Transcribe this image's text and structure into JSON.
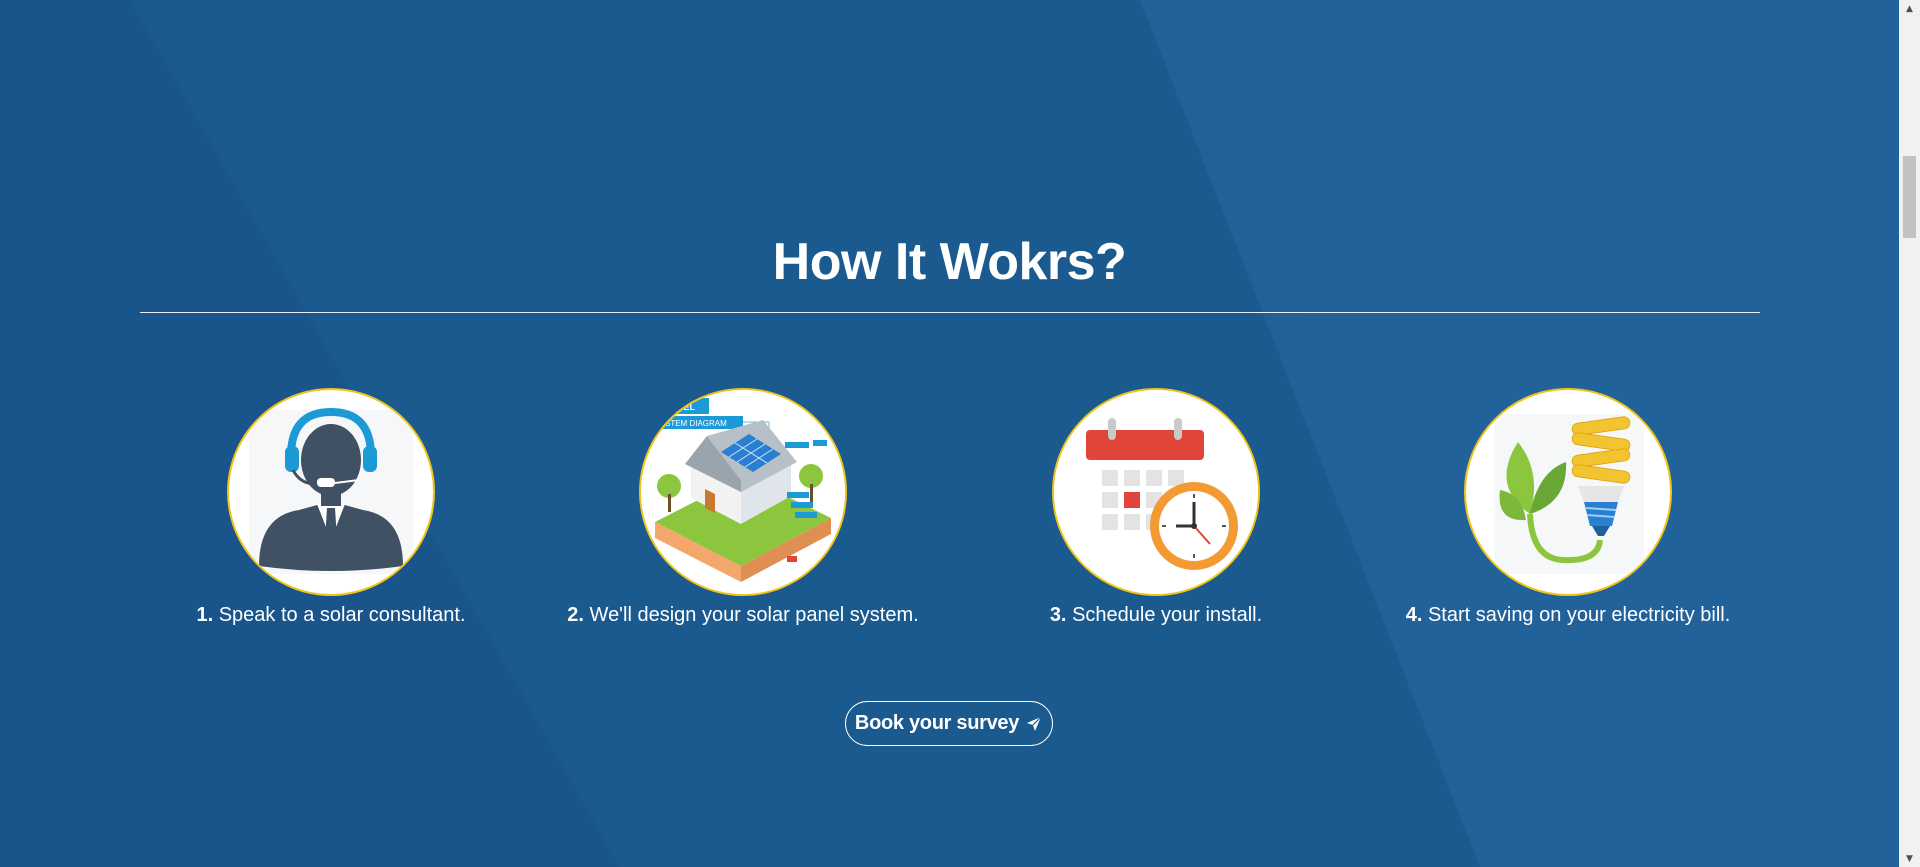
{
  "section": {
    "title": "How It Wokrs?"
  },
  "steps": [
    {
      "number": "1.",
      "text": "Speak to a solar consultant.",
      "icon": "consultant-headset-icon"
    },
    {
      "number": "2.",
      "text": "We'll design your solar panel system.",
      "icon": "solar-house-diagram-icon"
    },
    {
      "number": "3.",
      "text": "Schedule your install.",
      "icon": "calendar-clock-icon"
    },
    {
      "number": "4.",
      "text": "Start saving on your electricity bill.",
      "icon": "eco-bulb-icon"
    }
  ],
  "diagram_labels": {
    "panel": "NEL",
    "system_diagram": "STEM DIAGRAM"
  },
  "cta": {
    "label": "Book your survey",
    "icon": "paper-plane-icon"
  },
  "colors": {
    "background": "#1a5a8f",
    "accent_ring": "#f0c419",
    "text": "#ffffff"
  }
}
